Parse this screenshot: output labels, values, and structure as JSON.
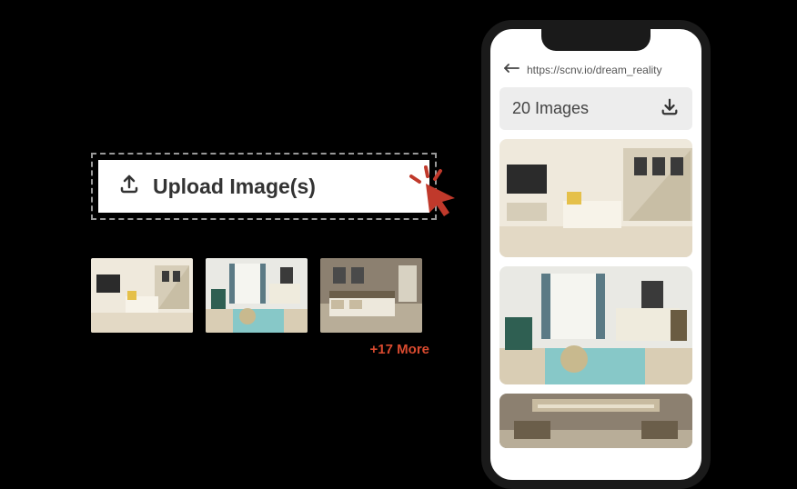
{
  "upload": {
    "button_label": "Upload Image(s)",
    "more_label": "+17 More"
  },
  "phone": {
    "url": "https://scnv.io/dream_reality",
    "header_title": "20 Images"
  }
}
